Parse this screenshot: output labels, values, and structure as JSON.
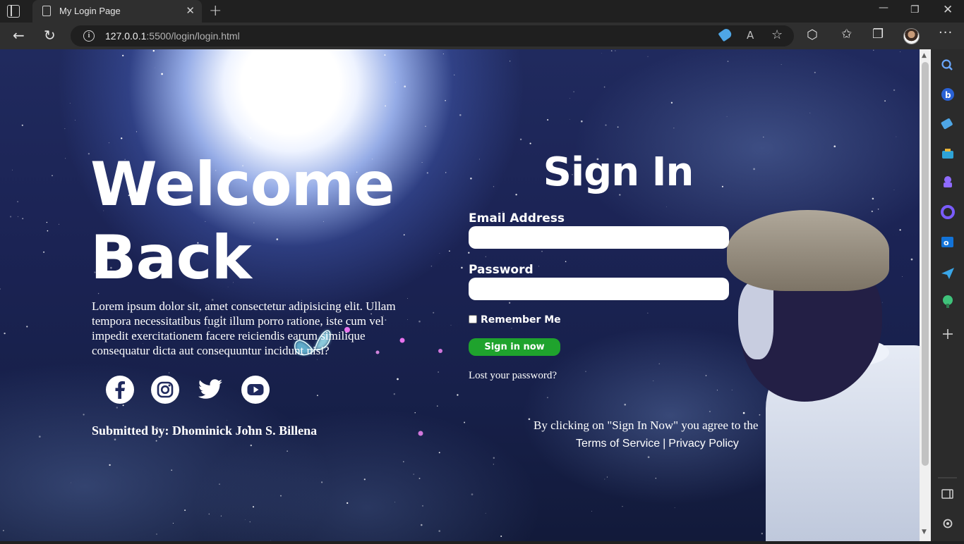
{
  "browser": {
    "tab_title": "My Login Page",
    "tab_close": "✕",
    "new_tab": "+",
    "url_host": "127.0.0.1",
    "url_rest": ":5500/login/login.html",
    "win_min": "—",
    "win_max": "❐",
    "win_close": "✕",
    "more": "···"
  },
  "left": {
    "welcome_line1": "Welcome",
    "welcome_line2": "Back",
    "lorem": "Lorem ipsum dolor sit, amet consectetur adipisicing elit. Ullam tempora necessitatibus fugit illum porro ratione, iste cum vel impedit exercitationem facere reiciendis earum similique consequatur dicta aut consequuntur incidunt nisi?",
    "socials": [
      "facebook-icon",
      "instagram-icon",
      "twitter-icon",
      "youtube-icon"
    ],
    "submitted_by": "Submitted by: Dhominick John S. Billena"
  },
  "form": {
    "title": "Sign In",
    "email_label": "Email Address",
    "email_value": "",
    "password_label": "Password",
    "password_value": "",
    "remember_label": "Remember Me",
    "remember_checked": false,
    "submit_label": "Sign in now",
    "lost_password": "Lost your password?",
    "agree_text": "By clicking on \"Sign In Now\" you agree to the",
    "terms_label": "Terms of Service",
    "separator": "|",
    "privacy_label": "Privacy Policy"
  },
  "colors": {
    "submit_button": "#1fa32d",
    "page_text": "#ffffff",
    "browser_chrome": "#2f2f2f"
  }
}
